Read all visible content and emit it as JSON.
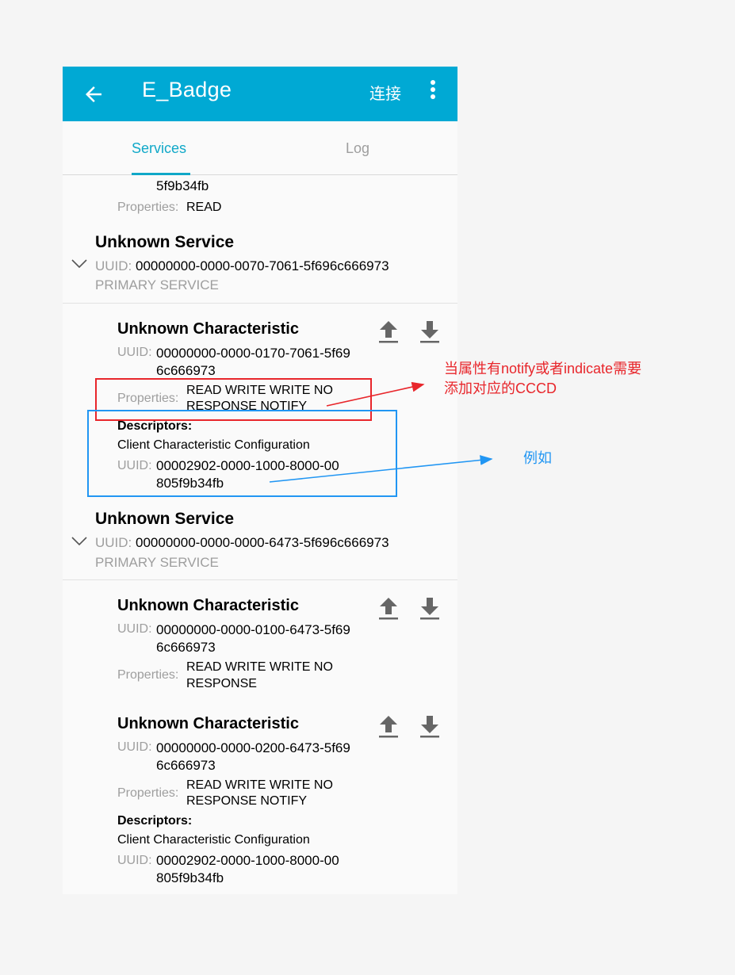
{
  "appbar": {
    "title": "E_Badge",
    "connect_label": "连接"
  },
  "tabs": {
    "services": "Services",
    "log": "Log"
  },
  "labels": {
    "uuid": "UUID:",
    "properties": "Properties:",
    "descriptors": "Descriptors:"
  },
  "top_fragment": {
    "uuid_line2": "5f9b34fb",
    "properties": "READ"
  },
  "services": [
    {
      "title": "Unknown Service",
      "uuid": "00000000-0000-0070-7061-5f696c666973",
      "type": "PRIMARY SERVICE",
      "characteristics": [
        {
          "title": "Unknown Characteristic",
          "uuid_line1": "00000000-0000-0170-7061-5f69",
          "uuid_line2": "6c666973",
          "props_line1": "READ WRITE WRITE NO",
          "props_line2": "RESPONSE NOTIFY",
          "descriptor": {
            "name": "Client Characteristic Configuration",
            "uuid_line1": "00002902-0000-1000-8000-00",
            "uuid_line2": "805f9b34fb"
          }
        }
      ]
    },
    {
      "title": "Unknown Service",
      "uuid": "00000000-0000-0000-6473-5f696c666973",
      "type": "PRIMARY SERVICE",
      "characteristics": [
        {
          "title": "Unknown Characteristic",
          "uuid_line1": "00000000-0000-0100-6473-5f69",
          "uuid_line2": "6c666973",
          "props_line1": "READ WRITE WRITE NO",
          "props_line2": "RESPONSE"
        },
        {
          "title": "Unknown Characteristic",
          "uuid_line1": "00000000-0000-0200-6473-5f69",
          "uuid_line2": "6c666973",
          "props_line1": "READ WRITE WRITE NO",
          "props_line2": "RESPONSE NOTIFY",
          "descriptor": {
            "name": "Client Characteristic Configuration",
            "uuid_line1": "00002902-0000-1000-8000-00",
            "uuid_line2": "805f9b34fb"
          }
        }
      ]
    }
  ],
  "annotations": {
    "red_note_line1": "当属性有notify或者indicate需要",
    "red_note_line2": "添加对应的CCCD",
    "blue_note": "例如"
  },
  "colors": {
    "appbar": "#00a9d4",
    "tab_active": "#10a8c8",
    "annotation_red": "#e8262b",
    "annotation_blue": "#2196f3"
  },
  "icons": [
    "back-arrow-icon",
    "more-vert-icon",
    "chevron-down-icon",
    "upload-icon",
    "download-icon"
  ]
}
